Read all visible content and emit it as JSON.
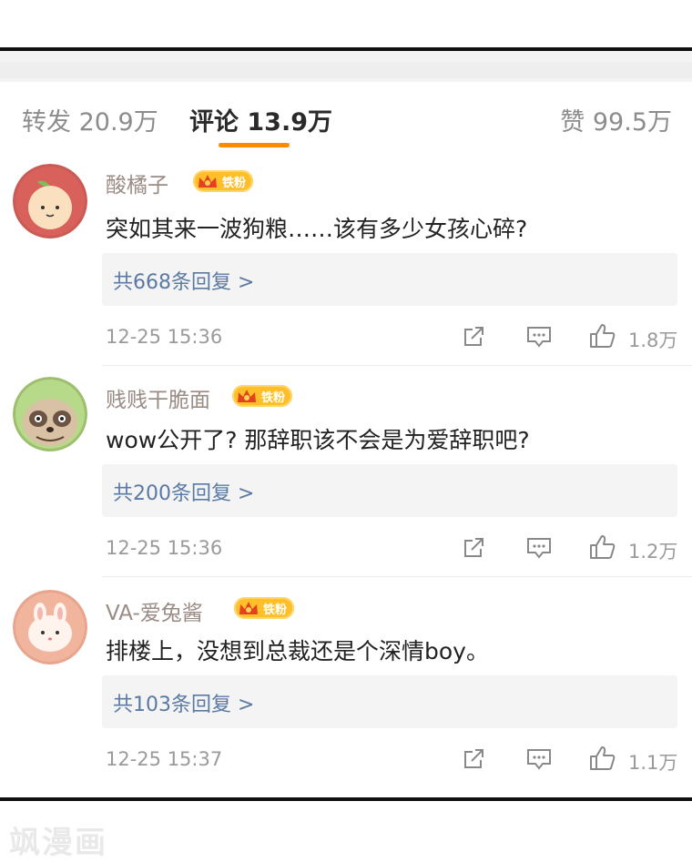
{
  "tabs": {
    "forward": "转发 20.9万",
    "comments": "评论 13.9万",
    "likes": "赞 99.5万"
  },
  "badge_label": "铁粉",
  "comments": [
    {
      "username": "酸橘子",
      "text": "突如其来一波狗粮……该有多少女孩心碎?",
      "replies": "共668条回复 >",
      "time": "12-25 15:36",
      "likes": "1.8万",
      "avatar": "orange-avatar"
    },
    {
      "username": "贱贱干脆面",
      "text": "wow公开了? 那辞职该不会是为爱辞职吧?",
      "replies": "共200条回复 >",
      "time": "12-25 15:36",
      "likes": "1.2万",
      "avatar": "raccoon-avatar"
    },
    {
      "username": "VA-爱兔酱",
      "text": "排楼上，没想到总裁还是个深情boy。",
      "replies": "共103条回复 >",
      "time": "12-25 15:37",
      "likes": "1.1万",
      "avatar": "rabbit-avatar"
    }
  ],
  "watermark": "飒漫画"
}
